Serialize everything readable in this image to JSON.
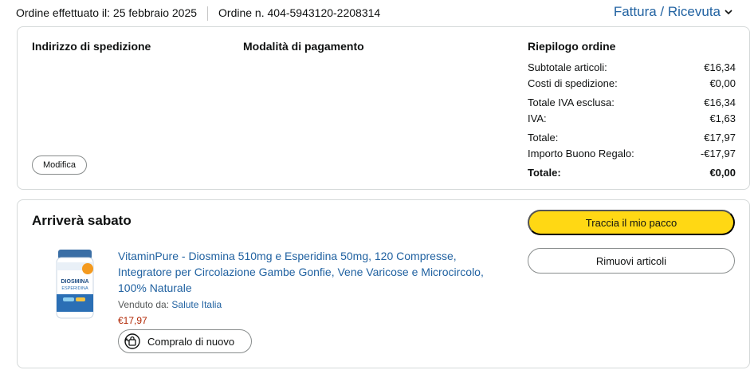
{
  "order": {
    "placed_label": "Ordine effettuato il: 25 febbraio 2025",
    "number_label": "Ordine n. 404-5943120-2208314",
    "invoice_link": "Fattura / Ricevuta"
  },
  "shipping": {
    "title": "Indirizzo di spedizione",
    "modify_label": "Modifica"
  },
  "payment": {
    "title": "Modalità di pagamento"
  },
  "summary": {
    "title": "Riepilogo ordine",
    "rows": [
      {
        "label": "Subtotale articoli:",
        "value": "€16,34"
      },
      {
        "label": "Costi di spedizione:",
        "value": "€0,00"
      },
      {
        "label": "Totale IVA esclusa:",
        "value": "€16,34"
      },
      {
        "label": "IVA:",
        "value": "€1,63"
      },
      {
        "label": "Totale:",
        "value": "€17,97"
      },
      {
        "label": "Importo Buono Regalo:",
        "value": "-€17,97"
      },
      {
        "label": "Totale:",
        "value": "€0,00"
      }
    ]
  },
  "shipment": {
    "title": "Arriverà sabato",
    "product_title": "VitaminPure - Diosmina 510mg e Esperidina 50mg, 120 Compresse, Integratore per Circolazione Gambe Gonfie, Vene Varicose e Microcircolo, 100% Naturale",
    "sold_by_label": "Venduto da:",
    "seller": "Salute Italia",
    "price": "€17,97",
    "buy_again_label": "Compralo di nuovo",
    "track_label": "Traccia il mio pacco",
    "remove_label": "Rimuovi articoli",
    "product_image_text": {
      "line1": "DIOSMINA",
      "line2": "ESPERIDINA"
    }
  },
  "colors": {
    "link": "#2162a1",
    "price": "#b12704",
    "primary_button": "#ffd814",
    "border": "#d5d9d9"
  }
}
